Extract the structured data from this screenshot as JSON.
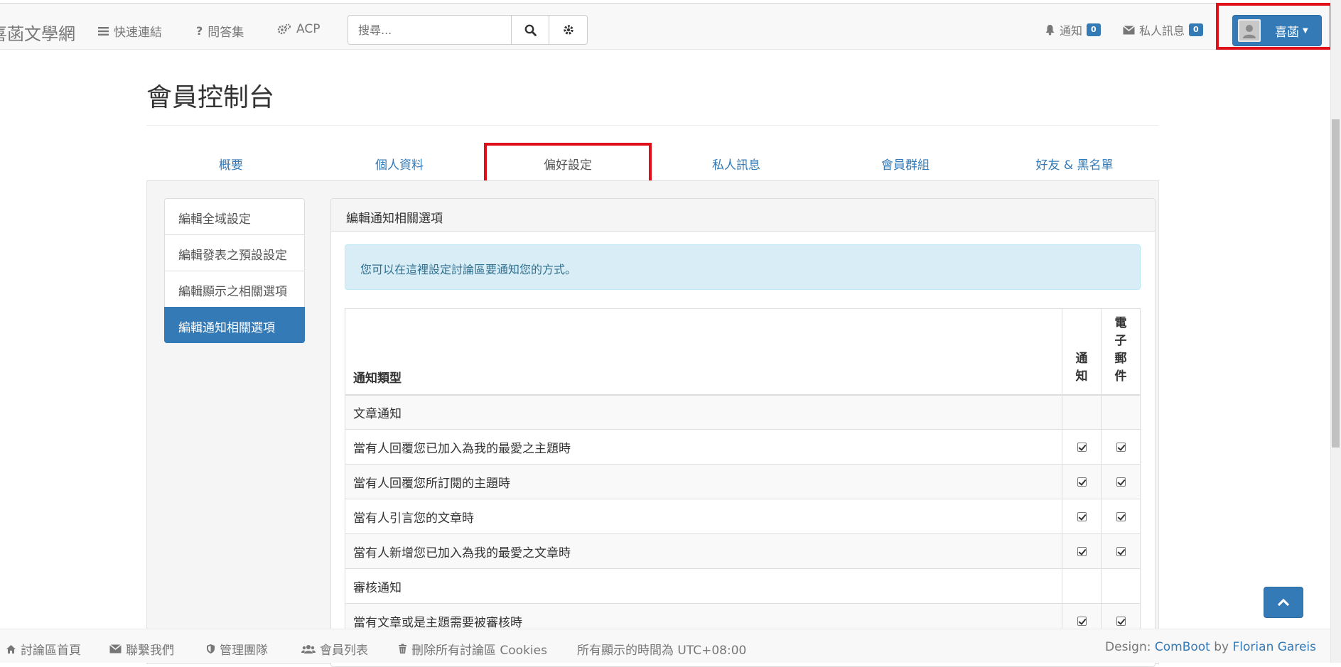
{
  "navbar": {
    "brand": "喜菡文學網",
    "links": [
      {
        "label": "快速連結",
        "icon": "bars-icon"
      },
      {
        "label": "問答集",
        "icon": "question-icon"
      },
      {
        "label": "ACP",
        "icon": "cogs-icon"
      }
    ],
    "search": {
      "placeholder": "搜尋..."
    },
    "notifications": {
      "label": "通知",
      "count": "0"
    },
    "messages": {
      "label": "私人訊息",
      "count": "0"
    },
    "user": {
      "name": "喜菡"
    }
  },
  "page": {
    "title": "會員控制台"
  },
  "tabs": [
    {
      "label": "概要",
      "active": false
    },
    {
      "label": "個人資料",
      "active": false
    },
    {
      "label": "偏好設定",
      "active": true
    },
    {
      "label": "私人訊息",
      "active": false
    },
    {
      "label": "會員群組",
      "active": false
    },
    {
      "label": "好友 & 黑名單",
      "active": false
    }
  ],
  "sidebar": {
    "items": [
      {
        "label": "編輯全域設定"
      },
      {
        "label": "編輯發表之預設設定"
      },
      {
        "label": "編輯顯示之相關選項"
      },
      {
        "label": "編輯通知相關選項",
        "active": true
      }
    ]
  },
  "panel": {
    "heading": "編輯通知相關選項",
    "info": "您可以在這裡設定討論區要通知您的方式。",
    "table": {
      "col_type": "通知類型",
      "col_notify": "通知",
      "col_email": "電子郵件",
      "rows": [
        {
          "kind": "group",
          "label": "文章通知"
        },
        {
          "kind": "item",
          "label": "當有人回覆您已加入為我的最愛之主題時",
          "notify": true,
          "email": true
        },
        {
          "kind": "item",
          "label": "當有人回覆您所訂閱的主題時",
          "notify": true,
          "email": true
        },
        {
          "kind": "item",
          "label": "當有人引言您的文章時",
          "notify": true,
          "email": true
        },
        {
          "kind": "item",
          "label": "當有人新增您已加入為我的最愛之文章時",
          "notify": true,
          "email": true
        },
        {
          "kind": "group",
          "label": "審核通知"
        },
        {
          "kind": "item",
          "label": "當有文章或是主題需要被審核時",
          "notify": true,
          "email": true
        }
      ]
    }
  },
  "footer": {
    "links": [
      {
        "label": "討論區首頁",
        "icon": "home-icon"
      },
      {
        "label": "聯繫我們",
        "icon": "envelope-icon"
      },
      {
        "label": "管理團隊",
        "icon": "shield-icon"
      },
      {
        "label": "會員列表",
        "icon": "users-icon"
      },
      {
        "label": "刪除所有討論區 Cookies",
        "icon": "trash-icon"
      }
    ],
    "timezone": "所有顯示的時間為 UTC+08:00",
    "credit_prefix": "Design:",
    "credit_theme": "ComBoot",
    "credit_by": "by",
    "credit_author": "Florian Gareis"
  },
  "colors": {
    "accent": "#337ab7",
    "highlight": "#e0101a"
  }
}
